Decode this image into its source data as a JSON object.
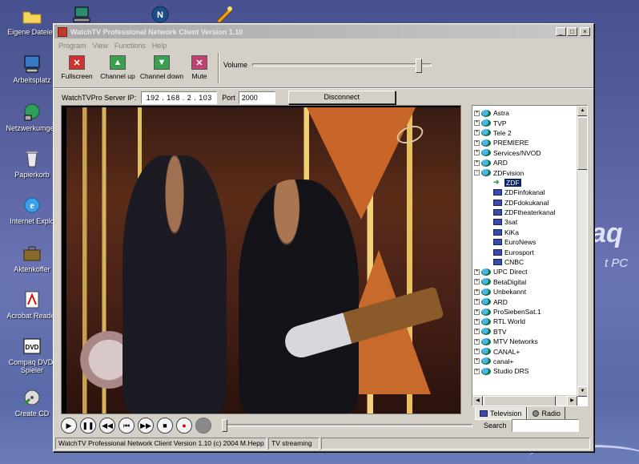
{
  "desktop": {
    "icons": [
      {
        "label": "Eigene Dateien",
        "icon": "folder-icon"
      },
      {
        "label": "",
        "icon": "network-computer-icon"
      },
      {
        "label": "",
        "icon": "netscape-icon"
      },
      {
        "label": "",
        "icon": "satellite-icon"
      },
      {
        "label": "Arbeitsplatz",
        "icon": "computer-icon"
      },
      {
        "label": "Netzwerkumgeb",
        "icon": "network-icon"
      },
      {
        "label": "Papierkorb",
        "icon": "recycle-bin-icon"
      },
      {
        "label": "Internet Explo",
        "icon": "internet-explorer-icon"
      },
      {
        "label": "Aktenkoffer",
        "icon": "briefcase-icon"
      },
      {
        "label": "Acrobat Reader",
        "icon": "acrobat-icon"
      },
      {
        "label": "Compaq DVD-Spieler",
        "icon": "dvd-icon"
      },
      {
        "label": "Create CD",
        "icon": "create-cd-icon"
      }
    ],
    "wallpaper_brand": "aq",
    "wallpaper_sub": "t PC"
  },
  "window": {
    "title": "WatchTV Professional Network Client Version 1.10",
    "controls": {
      "minimize": "_",
      "maximize": "□",
      "close": "×"
    }
  },
  "menu": [
    "Program",
    "View",
    "Functions",
    "Help"
  ],
  "toolbar": {
    "fullscreen": "Fullscreen",
    "channel_up": "Channel up",
    "channel_down": "Channel down",
    "mute": "Mute",
    "volume_label": "Volume",
    "volume_level": 0.95
  },
  "server": {
    "label": "WatchTVPro Server IP:",
    "ip": "192 . 168 .  2  . 103",
    "port_label": "Port",
    "port": "2000",
    "disconnect": "Disconnect"
  },
  "channels": {
    "groups_top": [
      "Astra",
      "TVP",
      "Tele 2",
      "PREMIERE",
      "Services/NVOD",
      "ARD"
    ],
    "expanded_group": "ZDFvision",
    "selected_channel": "ZDF",
    "children": [
      "ZDFinfokanal",
      "ZDFdokukanal",
      "ZDFtheaterkanal",
      "3sat",
      "KiKa",
      "EuroNews",
      "Eurosport",
      "CNBC"
    ],
    "groups_bottom": [
      "UPC Direct",
      "BetaDigital",
      "Unbekannt",
      "ARD",
      "ProSiebenSat.1",
      "RTL World",
      "BTV",
      "MTV Networks",
      "CANAL+",
      "canal+",
      "Studio DRS"
    ]
  },
  "tabs": {
    "television": "Television",
    "radio": "Radio"
  },
  "playback": {
    "controls": [
      "play",
      "pause",
      "step-back",
      "skip-back",
      "step-forward",
      "stop",
      "record",
      "disabled"
    ],
    "search_label": "Search",
    "search_value": ""
  },
  "status": {
    "main": "WatchTV Professional Network Client Version 1.10 (c) 2004 M.Hepp",
    "state": "TV streaming"
  },
  "colors": {
    "selection": "#0a246a",
    "record": "#cc0000",
    "window_face": "#d4d0c8"
  }
}
